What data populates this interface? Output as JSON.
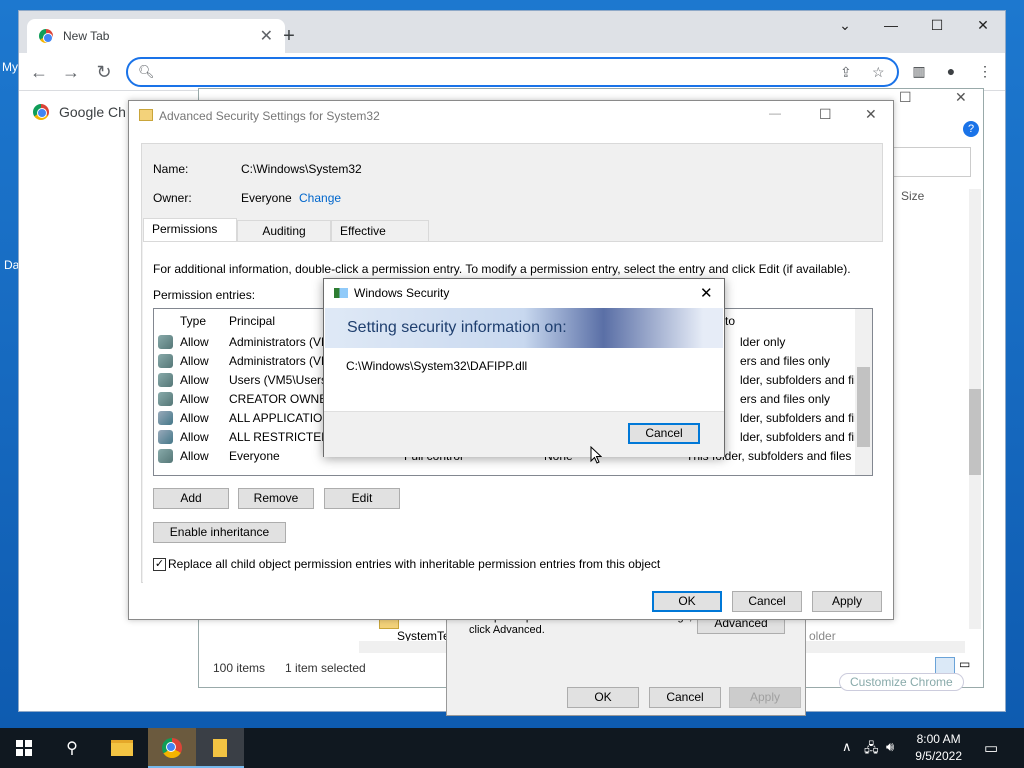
{
  "desktop": {
    "label1": "My",
    "label2": "Da"
  },
  "chrome": {
    "tab_title": "New Tab",
    "tab_close": "✕",
    "new_tab": "+",
    "omnibox_placeholder": "",
    "bookmark": "Google Ch",
    "min": "—",
    "max": "☐",
    "close": "✕",
    "collapse": "⌄"
  },
  "explorer": {
    "size_header": "Size",
    "item_count": "100 items",
    "selected": "1 item selected",
    "folder_item": "SystemTe",
    "older": "older",
    "customize": "Customize Chrome"
  },
  "props": {
    "special_text": "For special permissions or advanced settings, click Advanced.",
    "advanced": "Advanced",
    "ok": "OK",
    "cancel": "Cancel",
    "apply": "Apply"
  },
  "advanced": {
    "title": "Advanced Security Settings for System32",
    "name_label": "Name:",
    "name_value": "C:\\Windows\\System32",
    "owner_label": "Owner:",
    "owner_value": "Everyone",
    "change": "Change",
    "tabs": [
      "Permissions",
      "Auditing",
      "Effective Access"
    ],
    "info": "For additional information, double-click a permission entry. To modify a permission entry, select the entry and click Edit (if available).",
    "entries_label": "Permission entries:",
    "columns": {
      "type": "Type",
      "principal": "Principal",
      "applies": "to"
    },
    "rows": [
      {
        "type": "Allow",
        "principal": "Administrators (VM",
        "access": "",
        "inherited": "",
        "applies": "lder only"
      },
      {
        "type": "Allow",
        "principal": "Administrators (VM",
        "access": "",
        "inherited": "",
        "applies": "ers and files only"
      },
      {
        "type": "Allow",
        "principal": "Users (VM5\\Users)",
        "access": "",
        "inherited": "",
        "applies": "lder, subfolders and files"
      },
      {
        "type": "Allow",
        "principal": "CREATOR OWNER",
        "access": "",
        "inherited": "",
        "applies": "ers and files only"
      },
      {
        "type": "Allow",
        "principal": "ALL APPLICATION",
        "access": "",
        "inherited": "",
        "applies": "lder, subfolders and files"
      },
      {
        "type": "Allow",
        "principal": "ALL RESTRICTED A",
        "access": "",
        "inherited": "",
        "applies": "lder, subfolders and files"
      },
      {
        "type": "Allow",
        "principal": "Everyone",
        "access": "Full control",
        "inherited": "None",
        "applies": "This folder, subfolders and files"
      }
    ],
    "add": "Add",
    "remove": "Remove",
    "edit": "Edit",
    "enable_inheritance": "Enable inheritance",
    "replace_check": "✓",
    "replace_text": "Replace all child object permission entries with inheritable permission entries from this object",
    "ok": "OK",
    "cancel": "Cancel",
    "apply": "Apply"
  },
  "winsec": {
    "title": "Windows Security",
    "banner": "Setting security information on:",
    "path": "C:\\Windows\\System32\\DAFIPP.dll",
    "cancel": "Cancel",
    "close": "✕"
  },
  "taskbar": {
    "time": "8:00 AM",
    "date": "9/5/2022"
  }
}
